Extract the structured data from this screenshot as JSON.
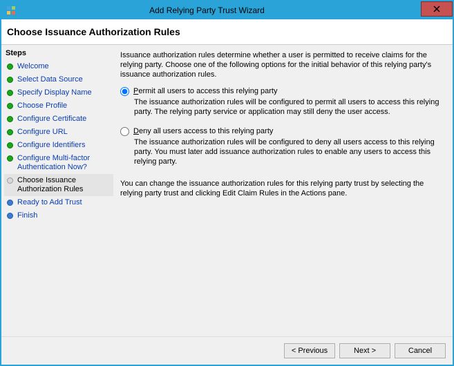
{
  "window": {
    "title": "Add Relying Party Trust Wizard"
  },
  "header": {
    "title": "Choose Issuance Authorization Rules"
  },
  "sidebar": {
    "label": "Steps",
    "items": [
      {
        "label": "Welcome",
        "state": "done"
      },
      {
        "label": "Select Data Source",
        "state": "done"
      },
      {
        "label": "Specify Display Name",
        "state": "done"
      },
      {
        "label": "Choose Profile",
        "state": "done"
      },
      {
        "label": "Configure Certificate",
        "state": "done"
      },
      {
        "label": "Configure URL",
        "state": "done"
      },
      {
        "label": "Configure Identifiers",
        "state": "done"
      },
      {
        "label": "Configure Multi-factor Authentication Now?",
        "state": "done"
      },
      {
        "label": "Choose Issuance Authorization Rules",
        "state": "current"
      },
      {
        "label": "Ready to Add Trust",
        "state": "todo"
      },
      {
        "label": "Finish",
        "state": "todo"
      }
    ]
  },
  "content": {
    "intro": "Issuance authorization rules determine whether a user is permitted to receive claims for the relying party. Choose one of the following options for the initial behavior of this relying party's issuance authorization rules.",
    "options": [
      {
        "id": "permit",
        "label_pre": "P",
        "label_rest": "ermit all users to access this relying party",
        "checked": true,
        "description": "The issuance authorization rules will be configured to permit all users to access this relying party. The relying party service or application may still deny the user access."
      },
      {
        "id": "deny",
        "label_pre": "D",
        "label_rest": "eny all users access to this relying party",
        "checked": false,
        "description": "The issuance authorization rules will be configured to deny all users access to this relying party. You must later add issuance authorization rules to enable any users to access this relying party."
      }
    ],
    "note": "You can change the issuance authorization rules for this relying party trust by selecting the relying party trust and clicking Edit Claim Rules in the Actions pane."
  },
  "footer": {
    "previous": "< Previous",
    "next": "Next >",
    "cancel": "Cancel"
  }
}
